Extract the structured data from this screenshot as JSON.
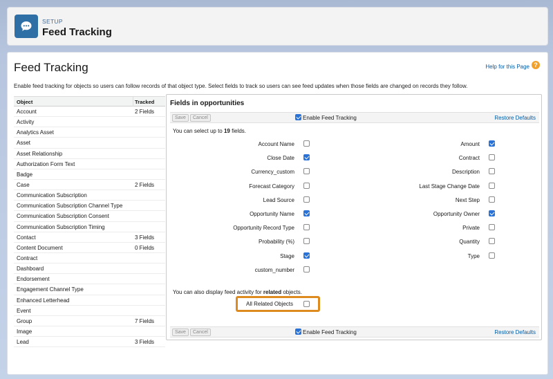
{
  "header": {
    "setup_label": "SETUP",
    "title": "Feed Tracking",
    "icon": "feed-chat-icon"
  },
  "page": {
    "title": "Feed Tracking",
    "help_link": "Help for this Page",
    "help_icon": "?",
    "description": "Enable feed tracking for objects so users can follow records of that object type. Select fields to track so users can see feed updates when those fields are changed on records they follow."
  },
  "objects": {
    "col_object": "Object",
    "col_tracked": "Tracked",
    "rows": [
      {
        "name": "Account",
        "tracked": "2 Fields"
      },
      {
        "name": "Activity",
        "tracked": ""
      },
      {
        "name": "Analytics Asset",
        "tracked": ""
      },
      {
        "name": "Asset",
        "tracked": ""
      },
      {
        "name": "Asset Relationship",
        "tracked": ""
      },
      {
        "name": "Authorization Form Text",
        "tracked": ""
      },
      {
        "name": "Badge",
        "tracked": ""
      },
      {
        "name": "Case",
        "tracked": "2 Fields"
      },
      {
        "name": "Communication Subscription",
        "tracked": ""
      },
      {
        "name": "Communication Subscription Channel Type",
        "tracked": ""
      },
      {
        "name": "Communication Subscription Consent",
        "tracked": ""
      },
      {
        "name": "Communication Subscription Timing",
        "tracked": ""
      },
      {
        "name": "Contact",
        "tracked": "3 Fields"
      },
      {
        "name": "Content Document",
        "tracked": "0 Fields"
      },
      {
        "name": "Contract",
        "tracked": ""
      },
      {
        "name": "Dashboard",
        "tracked": ""
      },
      {
        "name": "Endorsement",
        "tracked": ""
      },
      {
        "name": "Engagement Channel Type",
        "tracked": ""
      },
      {
        "name": "Enhanced Letterhead",
        "tracked": ""
      },
      {
        "name": "Event",
        "tracked": ""
      },
      {
        "name": "Group",
        "tracked": "7 Fields"
      },
      {
        "name": "Image",
        "tracked": ""
      },
      {
        "name": "Lead",
        "tracked": "3 Fields"
      }
    ]
  },
  "panel": {
    "title": "Fields in opportunities",
    "save": "Save",
    "cancel": "Cancel",
    "enable_label": "Enable Feed Tracking",
    "enable_checked": true,
    "restore": "Restore Defaults",
    "select_prefix": "You can select up to ",
    "select_count": "19",
    "select_suffix": " fields.",
    "left_fields": [
      {
        "label": "Account Name",
        "checked": false
      },
      {
        "label": "Close Date",
        "checked": true
      },
      {
        "label": "Currency_custom",
        "checked": false
      },
      {
        "label": "Forecast Category",
        "checked": false
      },
      {
        "label": "Lead Source",
        "checked": false
      },
      {
        "label": "Opportunity Name",
        "checked": true
      },
      {
        "label": "Opportunity Record Type",
        "checked": false
      },
      {
        "label": "Probability (%)",
        "checked": false
      },
      {
        "label": "Stage",
        "checked": true
      },
      {
        "label": "custom_number",
        "checked": false
      }
    ],
    "right_fields": [
      {
        "label": "Amount",
        "checked": true
      },
      {
        "label": "Contract",
        "checked": false
      },
      {
        "label": "Description",
        "checked": false
      },
      {
        "label": "Last Stage Change Date",
        "checked": false
      },
      {
        "label": "Next Step",
        "checked": false
      },
      {
        "label": "Opportunity Owner",
        "checked": true
      },
      {
        "label": "Private",
        "checked": false
      },
      {
        "label": "Quantity",
        "checked": false
      },
      {
        "label": "Type",
        "checked": false
      }
    ],
    "related_prefix": "You can also display feed activity for ",
    "related_bold": "related",
    "related_suffix": " objects.",
    "all_related_label": "All Related Objects",
    "all_related_checked": false
  }
}
